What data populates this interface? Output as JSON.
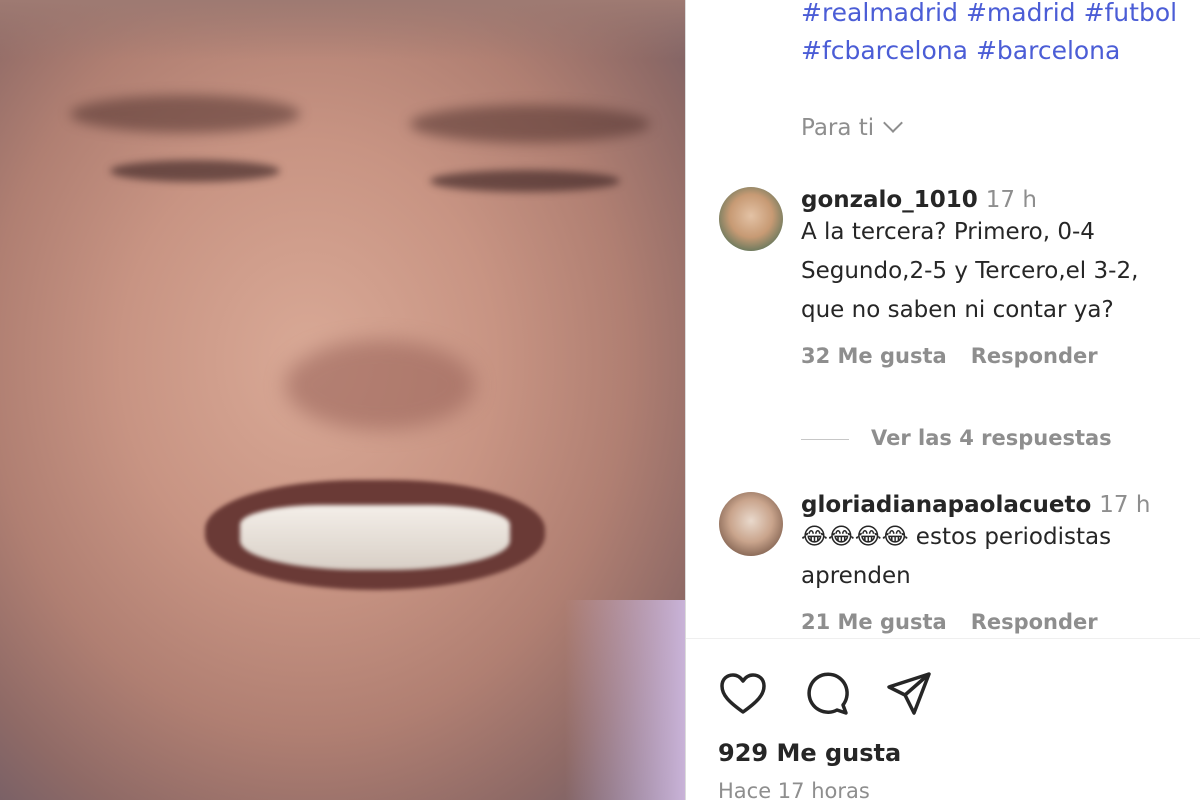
{
  "post": {
    "hashtags": [
      "#realmadrid",
      "#madrid",
      "#futbol",
      "#fcbarcelona",
      "#barcelona"
    ],
    "sort_label": "Para ti",
    "comments": [
      {
        "user": "gonzalo_1010",
        "time": "17 h",
        "text": "A la tercera? Primero, 0-4\nSegundo,2-5 y Tercero,el 3-2,\nque no saben ni contar ya?",
        "likes": "32 Me gusta",
        "reply_label": "Responder"
      },
      {
        "user": "gloriadianapaolacueto",
        "time": "17 h",
        "text": "😂😂😂😂 estos periodistas\naprenden",
        "likes": "21 Me gusta",
        "reply_label": "Responder"
      }
    ],
    "view_replies": "Ver las 4 respuestas",
    "likes_total": "929 Me gusta",
    "posted_ago": "Hace 17 horas",
    "icons": [
      "heart-icon",
      "comment-icon",
      "share-icon"
    ]
  }
}
